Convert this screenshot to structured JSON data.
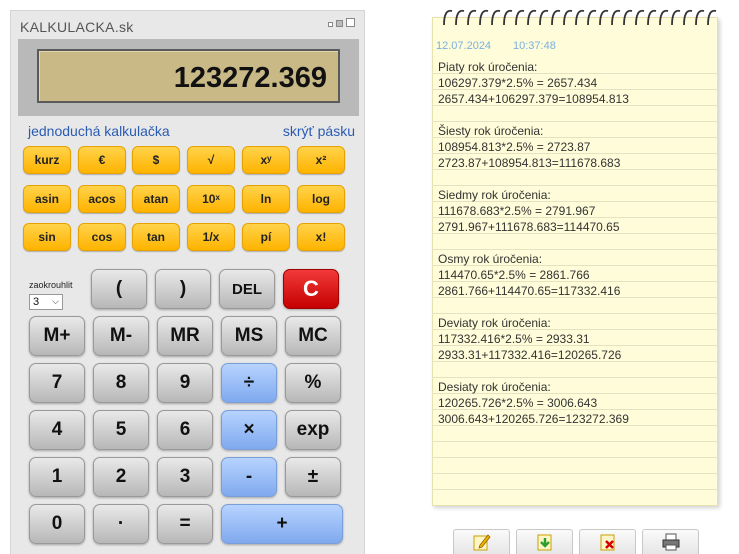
{
  "app": {
    "title": "KALKULACKA.sk"
  },
  "display": {
    "value": "123272.369"
  },
  "links": {
    "simple": "jednoduchá kalkulačka",
    "hide_tape": "skrýť pásku"
  },
  "function_rows": [
    [
      "kurz",
      "€",
      "$",
      "√",
      "xʸ",
      "x²"
    ],
    [
      "asin",
      "acos",
      "atan",
      "10ˣ",
      "ln",
      "log"
    ],
    [
      "sin",
      "cos",
      "tan",
      "1/x",
      "pí",
      "x!"
    ]
  ],
  "rounding": {
    "label": "zaokrouhlit",
    "value": "3"
  },
  "keys": {
    "open_paren": "(",
    "close_paren": ")",
    "del": "DEL",
    "clear": "C",
    "m_plus": "M+",
    "m_minus": "M-",
    "mr": "MR",
    "ms": "MS",
    "mc": "MC",
    "seven": "7",
    "eight": "8",
    "nine": "9",
    "divide": "÷",
    "percent": "%",
    "four": "4",
    "five": "5",
    "six": "6",
    "multiply": "×",
    "exp": "exp",
    "one": "1",
    "two": "2",
    "three": "3",
    "minus": "-",
    "plus_minus": "±",
    "zero": "0",
    "dot": "·",
    "equals": "=",
    "plus": "+"
  },
  "tape": {
    "date": "12.07.2024",
    "time": "10:37:48",
    "lines": [
      "Piaty rok úročenia:",
      "106297.379*2.5% = 2657.434",
      "2657.434+106297.379=108954.813",
      "",
      "Šiesty rok úročenia:",
      "108954.813*2.5% = 2723.87",
      "2723.87+108954.813=111678.683",
      "",
      "Siedmy rok úročenia:",
      "111678.683*2.5% = 2791.967",
      "2791.967+111678.683=114470.65",
      "",
      "Osmy rok úročenia:",
      "114470.65*2.5% = 2861.766",
      "2861.766+114470.65=117332.416",
      "",
      "Deviaty rok úročenia:",
      "117332.416*2.5% = 2933.31",
      "2933.31+117332.416=120265.726",
      "",
      "Desiaty rok úročenia:",
      "120265.726*2.5% = 3006.643",
      "3006.643+120265.726=123272.369"
    ]
  },
  "toolbar_icons": [
    "edit-icon",
    "download-icon",
    "delete-icon",
    "print-icon"
  ],
  "colors": {
    "yellow_key": "#ffc21a",
    "blue_key": "#8fb6f5",
    "red_key": "#d80000",
    "display_bg": "#c8b986",
    "link": "#2a5bb3",
    "tape_bg": "#fefcd9"
  }
}
